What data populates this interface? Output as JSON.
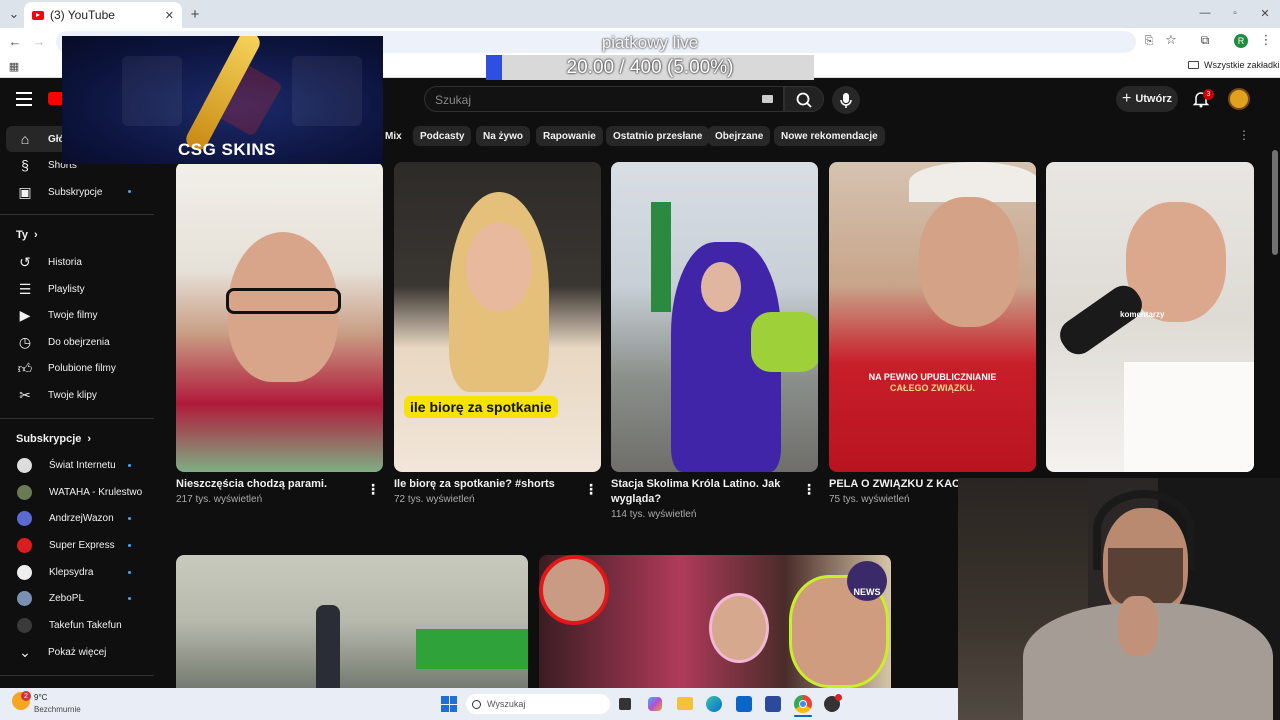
{
  "browser": {
    "tab_title": "(3) YouTube",
    "bookmarks_label": "Wszystkie zakładki",
    "profile_initial": "R"
  },
  "overlay": {
    "stream_title": "piatkowy live",
    "goal_progress_text": "20.00 / 400 (5.00%)",
    "goal_progress_fraction": 0.05,
    "ad_brand": "CSG SKINS"
  },
  "youtube": {
    "search_placeholder": "Szukaj",
    "create_label": "Utwórz",
    "notification_count": "3",
    "chips": [
      "Mix",
      "Podcasty",
      "Na żywo",
      "Rapowanie",
      "Ostatnio przesłane",
      "Obejrzane",
      "Nowe rekomendacje"
    ],
    "sidebar": {
      "home": "Główna",
      "shorts": "Shorts",
      "subscriptions": "Subskrypcje",
      "you_heading": "Ty",
      "you_items": [
        "Historia",
        "Playlisty",
        "Twoje filmy",
        "Do obejrzenia",
        "Polubione filmy",
        "Twoje klipy"
      ],
      "subs_heading": "Subskrypcje",
      "subs": [
        "Świat Internetu",
        "WATAHA - Krulestwo",
        "AndrzejWazon",
        "Super Express",
        "Klepsydra",
        "ZeboPL",
        "Takefun Takefun"
      ],
      "show_more": "Pokaż więcej"
    },
    "videos": [
      {
        "title": "Nieszczęścia chodzą parami.",
        "meta": "217 tys. wyświetleń"
      },
      {
        "title": "Ile biorę za spotkanie? #shorts",
        "meta": "72 tys. wyświetleń",
        "caption": "ile biorę za spotkanie"
      },
      {
        "title_line1": "Stacja Skolima Króla Latino. Jak",
        "title_line2": "wygląda?",
        "meta": "114 tys. wyświetleń"
      },
      {
        "title": "PELA O ZWIĄZKU Z KACZO",
        "meta": "75 tys. wyświetleń",
        "caption_line1": "NA PEWNO UPUBLICZNIANIE",
        "caption_line2": "CAŁEGO ZWIĄZKU."
      },
      {
        "caption": "komentarzy"
      }
    ],
    "news_badge": "NEWS"
  },
  "taskbar": {
    "weather_temp": "9°C",
    "weather_desc": "Bezchmurnie",
    "weather_badge": "2",
    "search_label": "Wyszukaj"
  }
}
